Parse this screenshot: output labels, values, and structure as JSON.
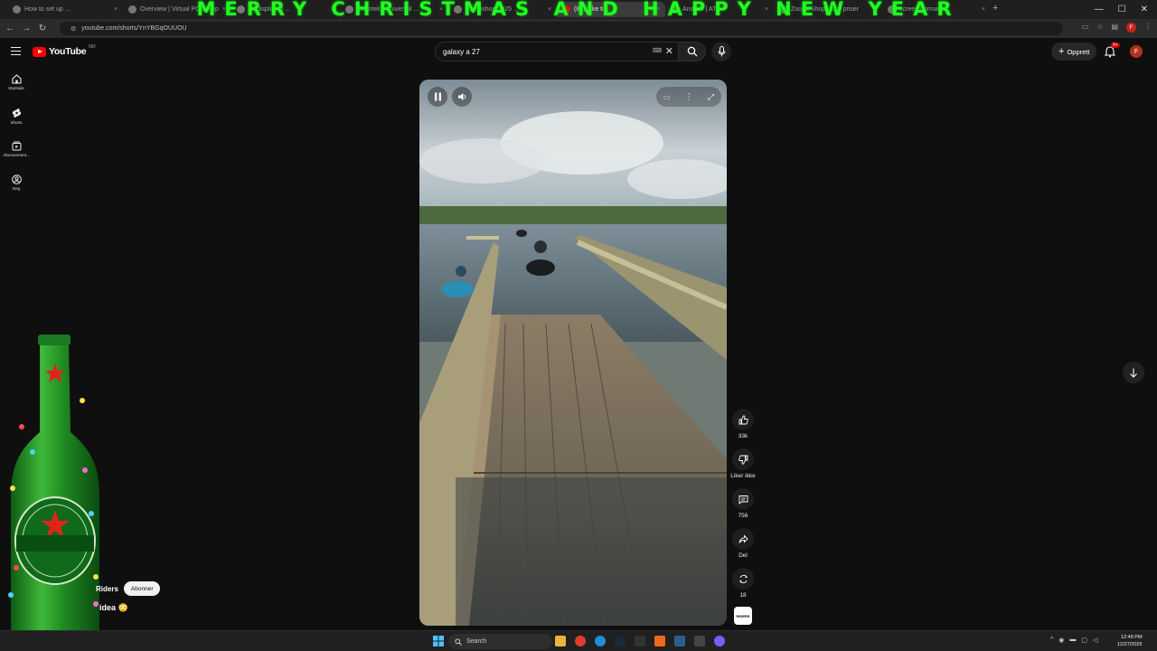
{
  "browser": {
    "banner": "MERRY CHRISTMAS AND HAPPY NEW YEAR",
    "tabs": [
      {
        "label": "How to set up ..."
      },
      {
        "label": "Overview | Virtual PC Comp"
      },
      {
        "label": "all display ai ... "
      },
      {
        "label": "Shantek | Universal ..."
      },
      {
        "label": "Photoshop 2025 ..."
      },
      {
        "label": "(88) Ikke ti..."
      },
      {
        "label": "Ansatte | AT..."
      },
      {
        "label": "Zoopa Shop - Lav priser"
      },
      {
        "label": "screen dormant ..."
      }
    ],
    "url": "youtube.com/shorts/YnYBGqOUUOU"
  },
  "youtube": {
    "logo_text": "YouTube",
    "country_code": "NO",
    "search_value": "galaxy a 27",
    "create_label": "Opprett",
    "notification_count": "9+",
    "avatar_letter": "F"
  },
  "guide": {
    "items": [
      {
        "label": "Startside",
        "icon": "home-icon"
      },
      {
        "label": "Shorts",
        "icon": "shorts-icon"
      },
      {
        "label": "Abonnement...",
        "icon": "subscriptions-icon"
      },
      {
        "label": "Deg",
        "icon": "you-icon"
      }
    ]
  },
  "short": {
    "actions": {
      "like_count": "33k",
      "dislike_label": "Liker ikke",
      "comment_count": "756",
      "share_label": "Del",
      "remix_count": "18"
    },
    "channel_name": "Riders",
    "subscribe_label": "Abonner",
    "title": "idea",
    "title_emoji": "😳",
    "channel_thumb_text": "RIDERS"
  },
  "taskbar": {
    "search_label": "Search",
    "time": "12:48 PM",
    "date": "12/27/2025"
  },
  "colors": {
    "accent_red": "#ff0000",
    "banner_green": "#22ff22",
    "background": "#0f0f0f"
  }
}
